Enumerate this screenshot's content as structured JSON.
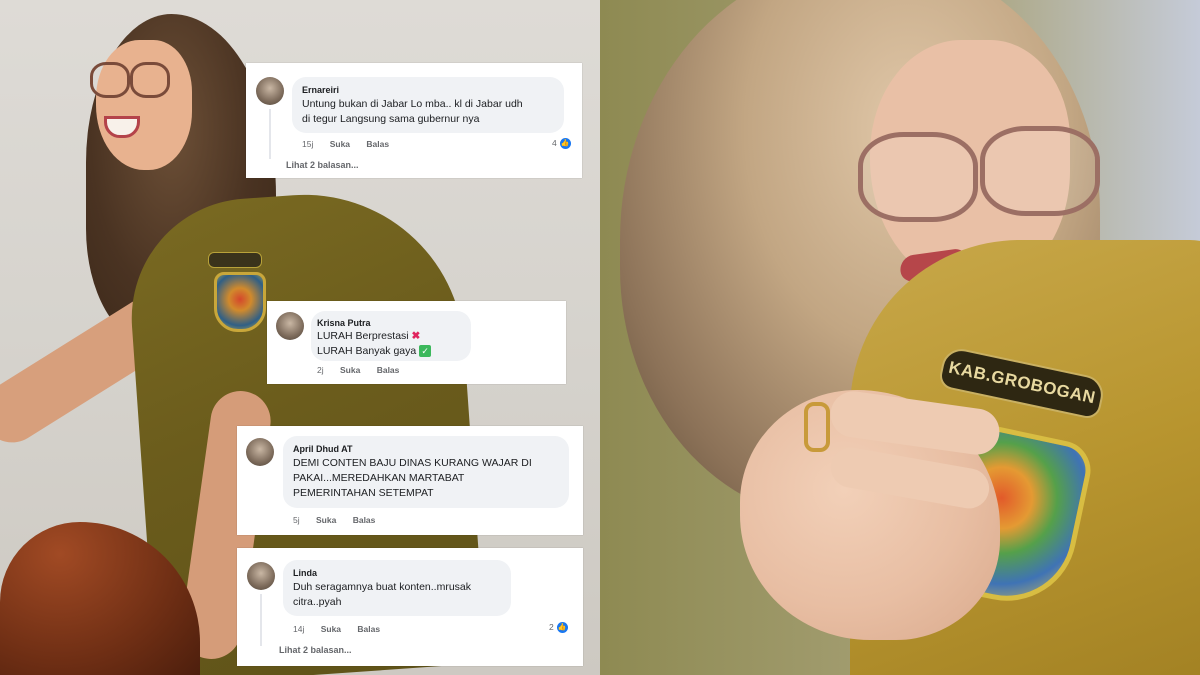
{
  "photos": {
    "left": {
      "description_icon": "woman-in-uniform-photo"
    },
    "right": {
      "patch_text": "KAB.GROBOGAN"
    }
  },
  "comments": [
    {
      "name": "Ernareiri",
      "lines": [
        "Untung bukan di Jabar Lo mba.. kl di Jabar udh",
        "di tegur Langsung sama gubernur nya"
      ],
      "time": "15j",
      "like_label": "Suka",
      "reply_label": "Balas",
      "like_count": "4",
      "view_replies": "Lihat 2 balasan..."
    },
    {
      "name": "Krisna Putra",
      "lines": [
        "LURAH Berprestasi",
        "LURAH Banyak gaya"
      ],
      "time": "2j",
      "like_label": "Suka",
      "reply_label": "Balas"
    },
    {
      "name": "April Dhud AT",
      "lines": [
        "DEMI CONTEN BAJU DINAS KURANG WAJAR DI",
        "PAKAI...MEREDAHKAN MARTABAT",
        "PEMERINTAHAN SETEMPAT"
      ],
      "time": "5j",
      "like_label": "Suka",
      "reply_label": "Balas"
    },
    {
      "name": "Linda",
      "lines": [
        "Duh seragamnya buat konten..mrusak",
        "citra..pyah"
      ],
      "time": "14j",
      "like_label": "Suka",
      "reply_label": "Balas",
      "like_count": "2",
      "view_replies": "Lihat 2 balasan..."
    }
  ],
  "colors": {
    "like_blue": "#1877f2",
    "bubble_gray": "#f0f2f5",
    "uniform_khaki": "#b8952f"
  }
}
